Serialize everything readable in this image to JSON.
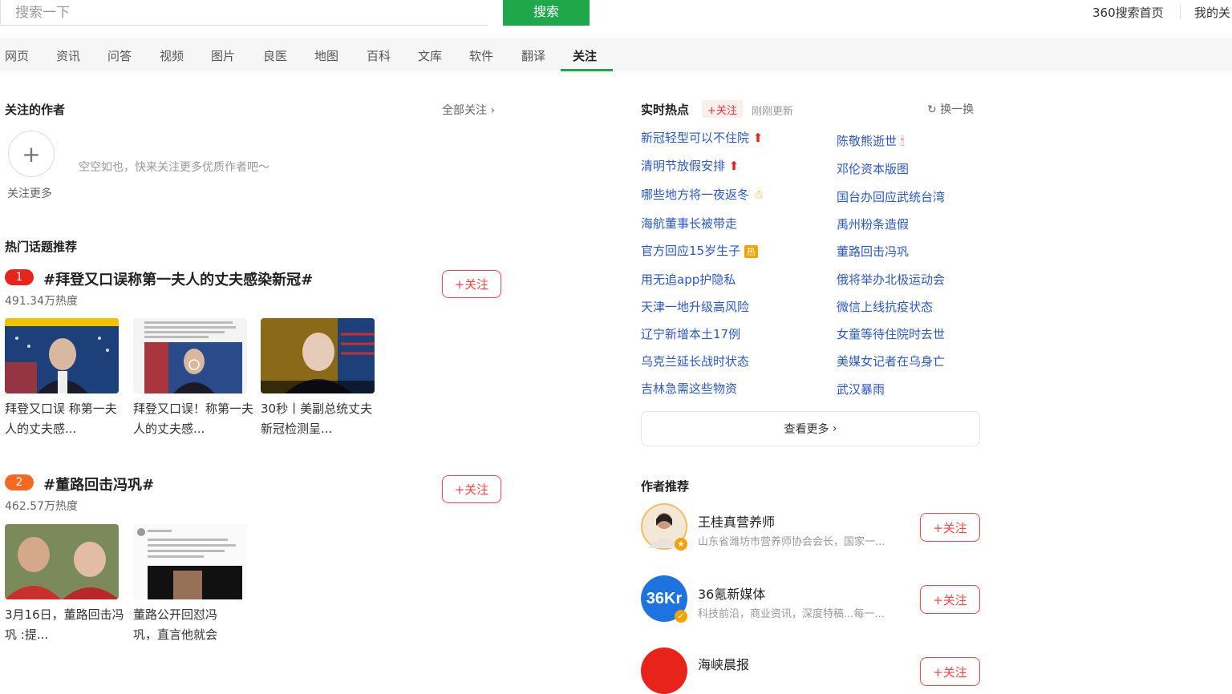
{
  "search": {
    "placeholder": "搜索一下",
    "button": "搜索"
  },
  "top_links": {
    "home": "360搜索首页",
    "mine": "我的关"
  },
  "nav": [
    "网页",
    "资讯",
    "问答",
    "视频",
    "图片",
    "良医",
    "地图",
    "百科",
    "文库",
    "软件",
    "翻译",
    "关注"
  ],
  "followed_authors": {
    "title": "关注的作者",
    "all_link": "全部关注",
    "empty_text": "空空如也，快来关注更多优质作者吧～",
    "follow_more": "关注更多"
  },
  "hot_topics": {
    "title": "热门话题推荐",
    "follow_label": "+关注",
    "items": [
      {
        "rank": "1",
        "title": "#拜登又口误称第一夫人的丈夫感染新冠#",
        "heat": "491.34万热度",
        "captions": [
          "拜登又口误 称第一夫人的丈夫感...",
          "拜登又口误！称第一夫人的丈夫感...",
          "30秒丨美副总统丈夫新冠检测呈..."
        ]
      },
      {
        "rank": "2",
        "title": "#董路回击冯巩#",
        "heat": "462.57万热度",
        "captions": [
          "3月16日，董路回击冯巩 :提...",
          "董路公开回怼冯巩，直言他就会"
        ]
      }
    ]
  },
  "realtime": {
    "title": "实时热点",
    "follow_tag": "+关注",
    "updated": "刚刚更新",
    "refresh": "换一换",
    "left": [
      "新冠轻型可以不住院",
      "清明节放假安排",
      "哪些地方将一夜返冬",
      "海航董事长被带走",
      "官方回应15岁生子",
      "用无追app护隐私",
      "天津一地升级高风险",
      "辽宁新增本土17例",
      "乌克兰延长战时状态",
      "吉林急需这些物资"
    ],
    "right": [
      "陈敬熊逝世",
      "邓伦资本版图",
      "国台办回应武统台湾",
      "禹州粉条造假",
      "董路回击冯巩",
      "俄将举办北极运动会",
      "微信上线抗疫状态",
      "女童等待住院时去世",
      "美媒女记者在乌身亡",
      "武汉暴雨"
    ],
    "hot_badge": "热",
    "more": "查看更多"
  },
  "authors": {
    "title": "作者推荐",
    "follow_label": "+关注",
    "items": [
      {
        "name": "王桂真营养师",
        "desc": "山东省潍坊市营养师协会会长，国家一..."
      },
      {
        "name": "36氪新媒体",
        "desc": "科技前沿，商业资讯，深度特稿...每一...",
        "logo": "36Kr"
      },
      {
        "name": "海峡晨报",
        "desc": ""
      }
    ]
  }
}
